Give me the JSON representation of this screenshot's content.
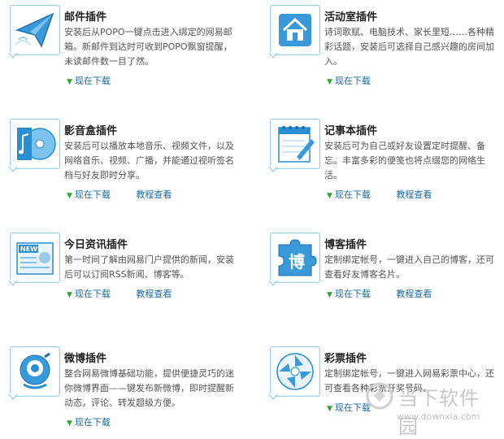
{
  "plugins": [
    {
      "title": "邮件插件",
      "desc": "安装后从POPO一键点击进入绑定的网易邮箱。新邮件到达时可收到POPO飘窗提醒，未读邮件数一目了然。",
      "download": "现在下载",
      "icon": "mail-icon"
    },
    {
      "title": "活动室插件",
      "desc": "诗词歌赋、电脑技术、家长里短……各种精彩话题，安装后可选择自己感兴趣的房间加入。",
      "download": "现在下载",
      "icon": "house-icon"
    },
    {
      "title": "影音盒插件",
      "desc": "安装后可以播放本地音乐、视频文件，以及网络音乐、视频、广播，并能通过视听签名档与好友即时分享。",
      "download": "现在下载",
      "tutorial": "教程查看",
      "icon": "music-disc-icon"
    },
    {
      "title": "记事本插件",
      "desc": "安装后可为自己或好友设置定时提醒、备忘。丰富多彩的便笺也将点缀您的网络生活。",
      "download": "现在下载",
      "tutorial": "教程查看",
      "icon": "notepad-icon"
    },
    {
      "title": "今日资讯插件",
      "desc": "第一时间了解由网易门户提供的新闻，安装后可以订阅RSS新闻、博客等。",
      "download": "现在下载",
      "tutorial": "教程查看",
      "icon": "news-icon",
      "icon_text": "NEWS"
    },
    {
      "title": "博客插件",
      "desc": "定制绑定帐号，一键进入自己的博客，还可查看好友博客名片。",
      "download": "现在下载",
      "tutorial": "教程查看",
      "icon": "blog-puzzle-icon",
      "icon_text": "博"
    },
    {
      "title": "微博插件",
      "desc": "整合网易微博基础功能，提供便捷灵巧的迷你微博界面——键发布新微博，即时提醒新动态，评论、转发超级方便。",
      "download": "现在下载",
      "icon": "weibo-icon"
    },
    {
      "title": "彩票插件",
      "desc": "定制绑定帐号，一键进入网易彩票中心，还可查看各种彩票开奖号码。",
      "download": "现在下载",
      "icon": "lottery-icon"
    }
  ],
  "watermark": {
    "name": "当下软件园",
    "url": "www.downxia.com"
  },
  "colors": {
    "link": "#1b6aa5",
    "icon_blue": "#2a8fd0",
    "arrow_green": "#3aa13a"
  }
}
